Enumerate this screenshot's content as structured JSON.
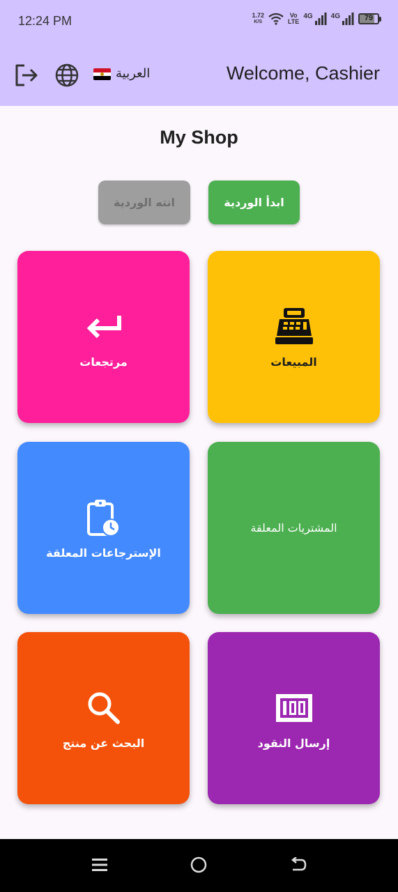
{
  "status_bar": {
    "time": "12:24 PM",
    "net_speed_value": "1.72",
    "net_speed_unit": "K/S",
    "volte_top": "Vo",
    "volte_bottom": "LTE",
    "sim1_label": "4G",
    "sim2_label": "4G",
    "battery_level": "79"
  },
  "app_bar": {
    "welcome_text": "Welcome, Cashier",
    "language_label": "العربية"
  },
  "shop_name": "My Shop",
  "shift_buttons": {
    "start_label": "ابدأ الوردية",
    "end_label": "انته الوردية"
  },
  "tiles": [
    {
      "id": "sales",
      "label": "المبيعات",
      "icon": "cash-register-icon",
      "color": "#ffc107",
      "label_color": "#1f1f1f"
    },
    {
      "id": "returns",
      "label": "مرتجعات",
      "icon": "return-arrow-icon",
      "color": "#ff1f9a",
      "label_color": "#ffffff"
    },
    {
      "id": "pending-purchases",
      "label": "المشتريات المعلقة",
      "icon": "",
      "color": "#4caf50",
      "label_color": "#ffffff"
    },
    {
      "id": "pending-returns",
      "label": "الإسترجاعات المعلقة",
      "icon": "clipboard-clock-icon",
      "color": "#448aff",
      "label_color": "#ffffff"
    },
    {
      "id": "send-money",
      "label": "إرسال النقود",
      "icon": "money-bill-icon",
      "color": "#9c27b0",
      "label_color": "#ffffff"
    },
    {
      "id": "product-search",
      "label": "البحث عن منتج",
      "icon": "search-icon",
      "color": "#f4510b",
      "label_color": "#ffffff"
    }
  ],
  "colors": {
    "app_bar": "#d2c2ff",
    "background": "#fcf7fd",
    "start_shift": "#4caf50",
    "end_shift_disabled": "#9e9e9e"
  }
}
